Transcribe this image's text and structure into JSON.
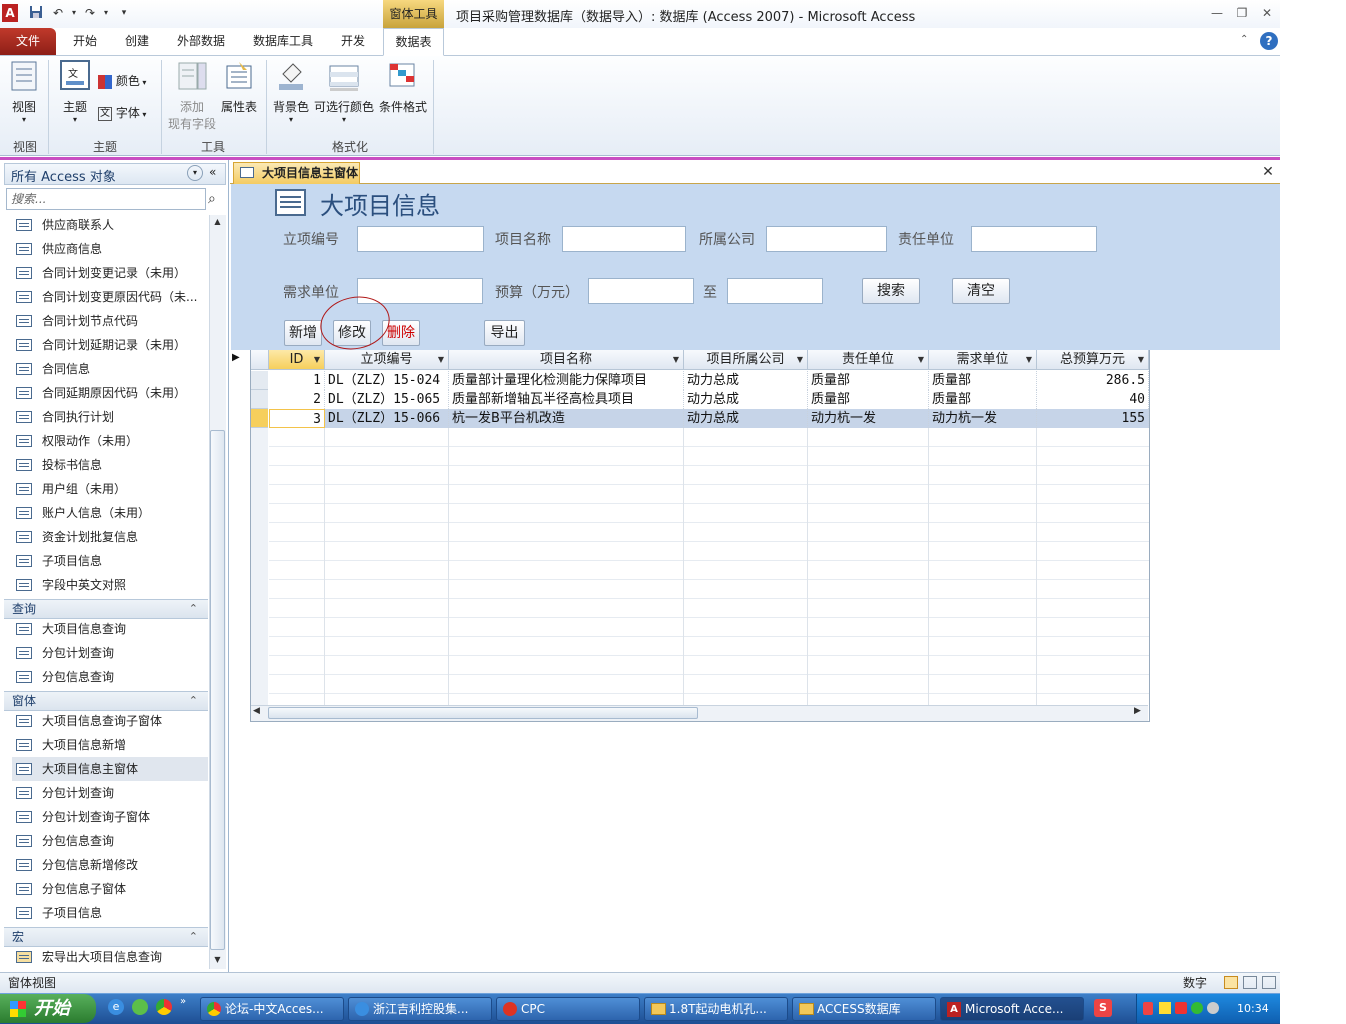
{
  "window": {
    "title": "项目采购管理数据库（数据导入）: 数据库 (Access 2007) - Microsoft Access",
    "context_tab": "窗体工具",
    "app_icon_letter": "A"
  },
  "tabs": [
    "文件",
    "开始",
    "创建",
    "外部数据",
    "数据库工具",
    "开发",
    "数据表"
  ],
  "ribbon": {
    "groups": [
      {
        "label": "视图",
        "buttons": [
          "视图"
        ]
      },
      {
        "label": "主题",
        "buttons": [
          "主题",
          "颜色",
          "字体"
        ]
      },
      {
        "label": "工具",
        "buttons": [
          "添加",
          "现有字段",
          "属性表"
        ]
      },
      {
        "label": "格式化",
        "buttons": [
          "背景色",
          "可选行颜色",
          "条件格式"
        ]
      }
    ]
  },
  "nav": {
    "header": "所有 Access 对象",
    "search_placeholder": "搜索...",
    "tables": [
      "供应商联系人",
      "供应商信息",
      "合同计划变更记录（未用）",
      "合同计划变更原因代码（未...",
      "合同计划节点代码",
      "合同计划延期记录（未用）",
      "合同信息",
      "合同延期原因代码（未用）",
      "合同执行计划",
      "权限动作（未用）",
      "投标书信息",
      "用户组（未用）",
      "账户人信息（未用）",
      "资金计划批复信息",
      "子项目信息",
      "字段中英文对照"
    ],
    "query_group": "查询",
    "queries": [
      "大项目信息查询",
      "分包计划查询",
      "分包信息查询"
    ],
    "form_group": "窗体",
    "forms": [
      "大项目信息查询子窗体",
      "大项目信息新增",
      "大项目信息主窗体",
      "分包计划查询",
      "分包计划查询子窗体",
      "分包信息查询",
      "分包信息新增修改",
      "分包信息子窗体",
      "子项目信息"
    ],
    "macro_group": "宏",
    "macros": [
      "宏导出大项目信息查询"
    ]
  },
  "doc": {
    "tab_label": "大项目信息主窗体",
    "form_title": "大项目信息",
    "labels": {
      "project_no": "立项编号",
      "project_name": "项目名称",
      "company": "所属公司",
      "resp_unit": "责任单位",
      "demand_unit": "需求单位",
      "budget": "预算（万元）",
      "to": "至"
    },
    "buttons": {
      "search": "搜索",
      "clear": "清空",
      "add": "新增",
      "edit": "修改",
      "delete": "删除",
      "export": "导出"
    }
  },
  "table": {
    "columns": [
      "ID",
      "立项编号",
      "项目名称",
      "项目所属公司",
      "责任单位",
      "需求单位",
      "总预算万元"
    ],
    "rows": [
      [
        "1",
        "DL（ZLZ）15-024",
        "质量部计量理化检测能力保障项目",
        "动力总成",
        "质量部",
        "质量部",
        "286.5"
      ],
      [
        "2",
        "DL（ZLZ）15-065",
        "质量部新增轴瓦半径高检具项目",
        "动力总成",
        "质量部",
        "质量部",
        "40"
      ],
      [
        "3",
        "DL（ZLZ）15-066",
        "杭一发B平台机改造",
        "动力总成",
        "动力杭一发",
        "动力杭一发",
        "155"
      ]
    ]
  },
  "status": {
    "left": "窗体视图",
    "right": "数字"
  },
  "taskbar": {
    "start": "开始",
    "items": [
      "论坛-中文Acces...",
      "浙江吉利控股集...",
      "CPC",
      "1.8T起动电机孔...",
      "ACCESS数据库",
      "Microsoft Acce..."
    ],
    "clock": "10:34"
  },
  "colors": {
    "file_tab": "#c0392b",
    "form_header": "#c6d9f0",
    "context_tab": "#e6c35a",
    "selected_row": "#c6d4e8"
  }
}
